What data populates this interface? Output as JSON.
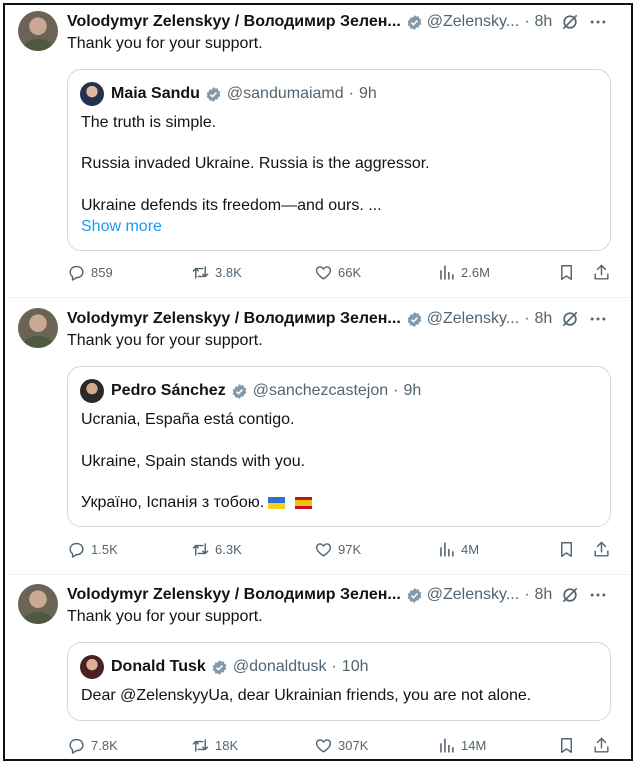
{
  "tweets": [
    {
      "author_name": "Volodymyr Zelenskyy / Володимир Зелен...",
      "handle": "@Zelensky...",
      "time": "8h",
      "text": "Thank you for your support.",
      "quote": {
        "name": "Maia Sandu",
        "handle": "@sandumaiamd",
        "time": "9h",
        "lines": [
          "The truth is simple.",
          "Russia invaded Ukraine. Russia is the aggressor.",
          "Ukraine defends its freedom—and ours. ..."
        ],
        "show_more": "Show more"
      },
      "stats": {
        "replies": "859",
        "reposts": "3.8K",
        "likes": "66K",
        "views": "2.6M"
      }
    },
    {
      "author_name": "Volodymyr Zelenskyy / Володимир Зелен...",
      "handle": "@Zelensky...",
      "time": "8h",
      "text": "Thank you for your support.",
      "quote": {
        "name": "Pedro Sánchez",
        "handle": "@sanchezcastejon",
        "time": "9h",
        "lines": [
          "Ucrania, España está contigo.",
          "Ukraine, Spain stands with you.",
          "Україно, Іспанія з тобою."
        ]
      },
      "stats": {
        "replies": "1.5K",
        "reposts": "6.3K",
        "likes": "97K",
        "views": "4M"
      }
    },
    {
      "author_name": "Volodymyr Zelenskyy / Володимир Зелен...",
      "handle": "@Zelensky...",
      "time": "8h",
      "text": "Thank you for your support.",
      "quote": {
        "name": "Donald Tusk",
        "handle": "@donaldtusk",
        "time": "10h",
        "lines": [
          "Dear @ZelenskyyUa, dear Ukrainian friends, you are not alone."
        ]
      },
      "stats": {
        "replies": "7.8K",
        "reposts": "18K",
        "likes": "307K",
        "views": "14M"
      }
    }
  ],
  "separator": "·",
  "colors": {
    "text": "#0f1419",
    "secondary": "#536471",
    "link": "#1d9bf0",
    "verified": "#829aab",
    "border": "#cfd9de"
  }
}
